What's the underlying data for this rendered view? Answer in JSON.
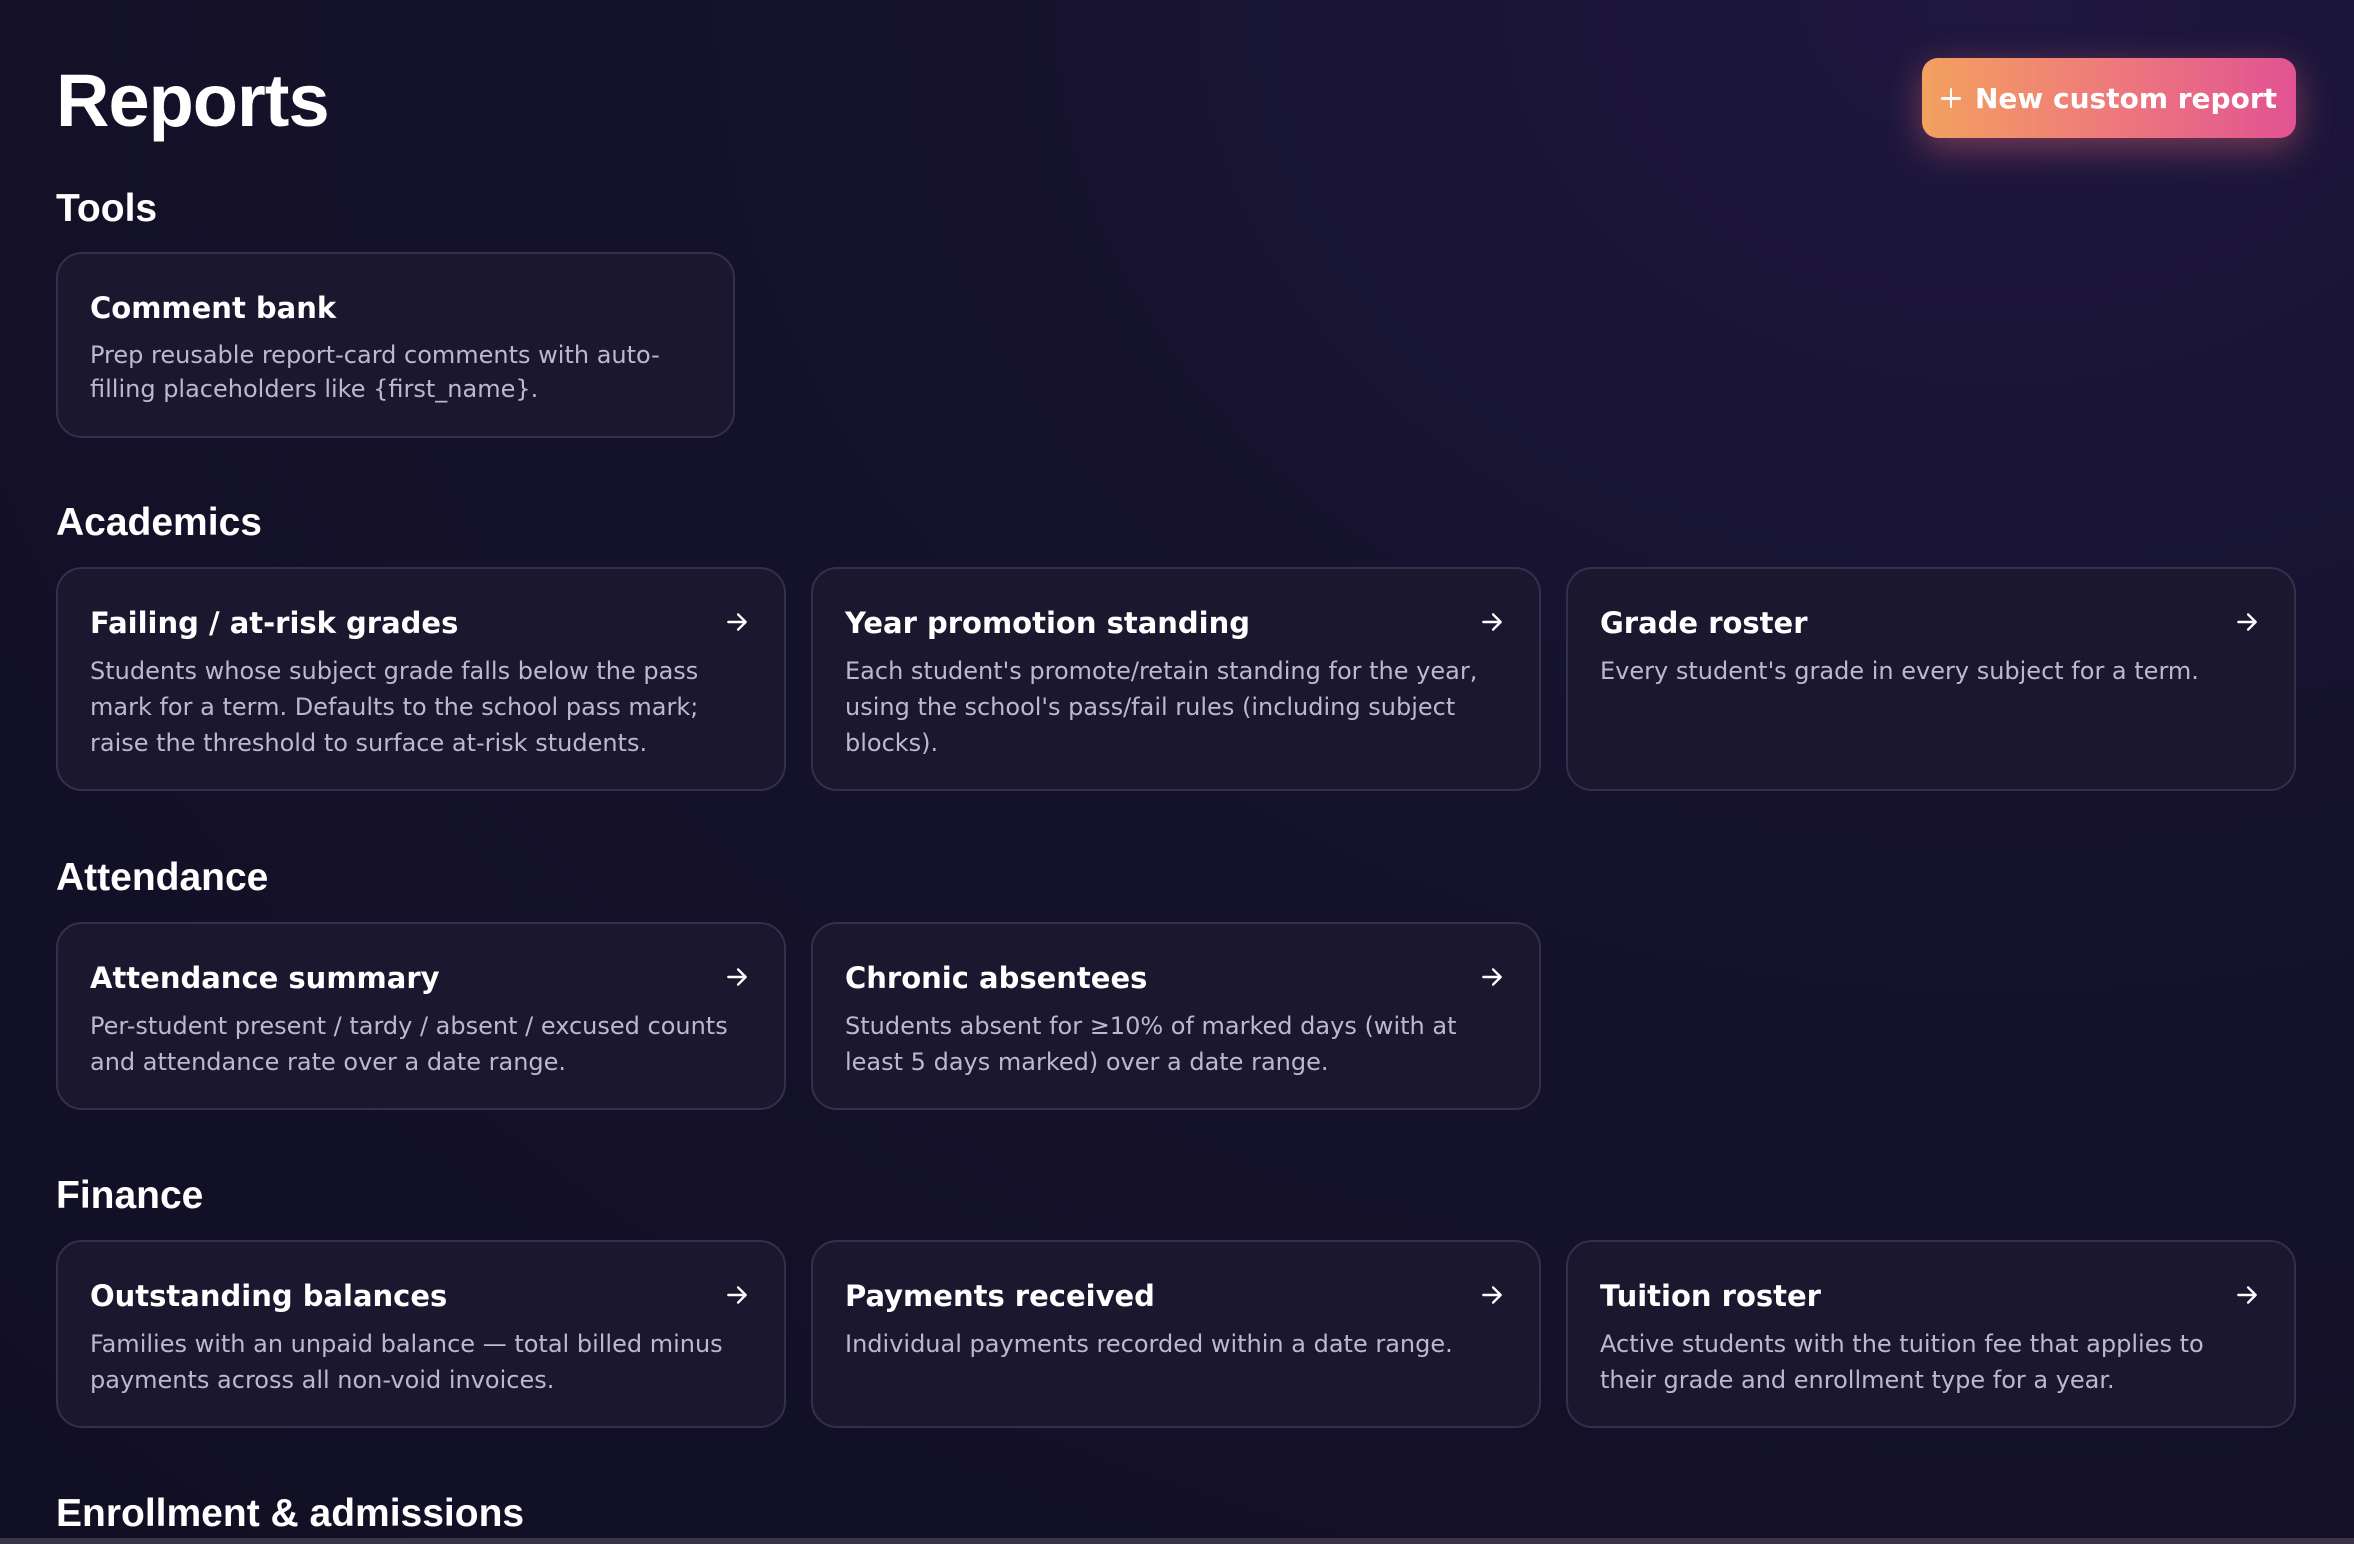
{
  "header": {
    "title": "Reports",
    "new_report_label": "New custom report"
  },
  "sections": [
    {
      "title": "Tools",
      "cards": [
        {
          "title": "Comment bank",
          "desc": "Prep reusable report-card comments with auto-filling placeholders like {first_name}."
        }
      ]
    },
    {
      "title": "Academics",
      "cards": [
        {
          "title": "Failing / at-risk grades",
          "desc": "Students whose subject grade falls below the pass mark for a term. Defaults to the school pass mark; raise the threshold to surface at-risk students."
        },
        {
          "title": "Year promotion standing",
          "desc": "Each student's promote/retain standing for the year, using the school's pass/fail rules (including subject blocks)."
        },
        {
          "title": "Grade roster",
          "desc": "Every student's grade in every subject for a term."
        }
      ]
    },
    {
      "title": "Attendance",
      "cards": [
        {
          "title": "Attendance summary",
          "desc": "Per-student present / tardy / absent / excused counts and attendance rate over a date range."
        },
        {
          "title": "Chronic absentees",
          "desc": "Students absent for ≥10% of marked days (with at least 5 days marked) over a date range."
        }
      ]
    },
    {
      "title": "Finance",
      "cards": [
        {
          "title": "Outstanding balances",
          "desc": "Families with an unpaid balance — total billed minus payments across all non-void invoices."
        },
        {
          "title": "Payments received",
          "desc": "Individual payments recorded within a date range."
        },
        {
          "title": "Tuition roster",
          "desc": "Active students with the tuition fee that applies to their grade and enrollment type for a year."
        }
      ]
    },
    {
      "title": "Enrollment & admissions",
      "cards": []
    }
  ]
}
